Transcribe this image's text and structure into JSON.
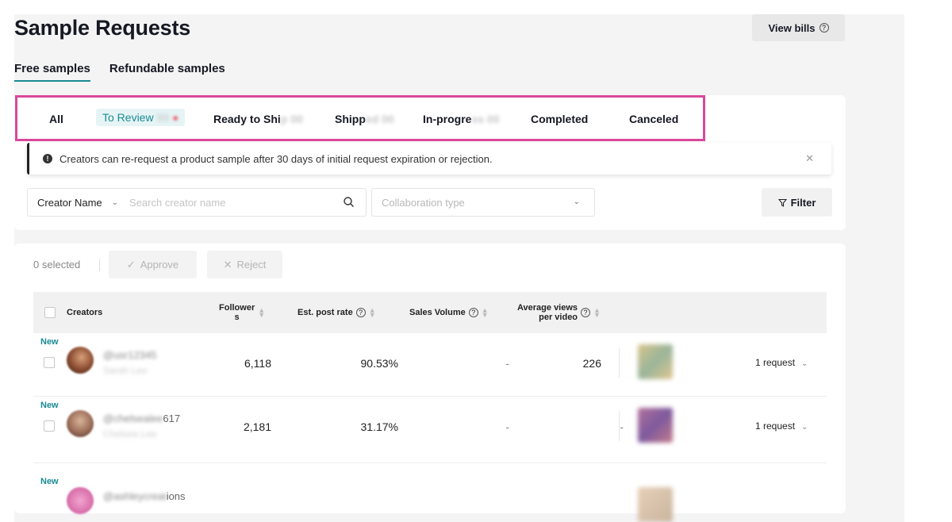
{
  "page": {
    "title": "Sample Requests",
    "view_bills": "View bills"
  },
  "sample_tabs": [
    "Free samples",
    "Refundable samples"
  ],
  "status_tabs": {
    "all": "All",
    "to_review": "To Review",
    "ready_to_ship": "Ready to Shi",
    "shipped": "Shipp",
    "in_progress": "In-progre",
    "completed": "Completed",
    "canceled": "Canceled"
  },
  "notice": {
    "text": "Creators can re-request a product sample after 30 days of initial request expiration or rejection."
  },
  "filters": {
    "creator_select": "Creator Name",
    "search_placeholder": "Search creator name",
    "collab_placeholder": "Collaboration type",
    "filter_label": "Filter"
  },
  "bulk": {
    "selected": "0 selected",
    "approve": "Approve",
    "reject": "Reject"
  },
  "table": {
    "headers": {
      "creators": "Creators",
      "followers_1": "Follower",
      "followers_2": "s",
      "post_rate": "Est. post rate",
      "sales_volume": "Sales Volume",
      "avg_views_1": "Average views",
      "avg_views_2": "per video"
    },
    "rows": [
      {
        "badge": "New",
        "handle_visible": "",
        "followers": "6,118",
        "post_rate": "90.53%",
        "sales": "-",
        "avg_views": "226",
        "requests": "1 request"
      },
      {
        "badge": "New",
        "handle_visible": "617",
        "followers": "2,181",
        "post_rate": "31.17%",
        "sales": "-",
        "avg_views": "-",
        "requests": "1 request"
      },
      {
        "badge": "New",
        "handle_visible": "ions",
        "followers": "",
        "post_rate": "",
        "sales": "",
        "avg_views": "",
        "requests": ""
      }
    ]
  },
  "colors": {
    "accent": "#1a8a93",
    "highlight_border": "#d9489b",
    "panel_bg": "#f4f4f5"
  }
}
